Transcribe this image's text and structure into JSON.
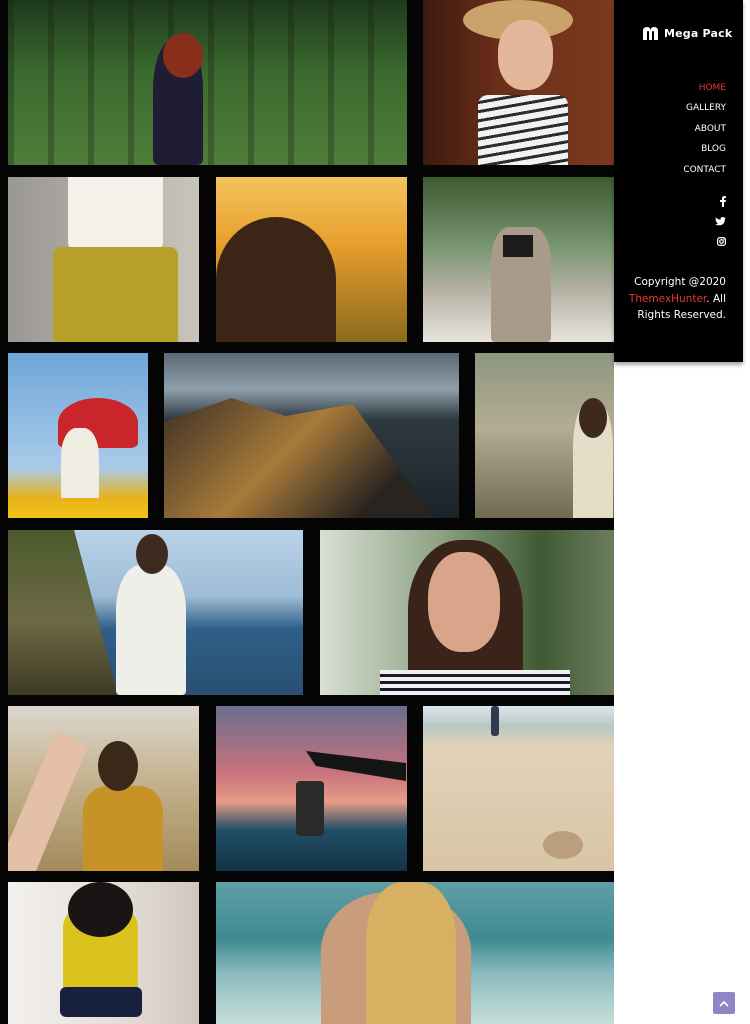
{
  "brand": {
    "name": "Mega Pack",
    "icon": "m-logo-icon"
  },
  "nav": {
    "items": [
      {
        "label": "HOME",
        "active": true
      },
      {
        "label": "GALLERY",
        "active": false
      },
      {
        "label": "ABOUT",
        "active": false
      },
      {
        "label": "BLOG",
        "active": false
      },
      {
        "label": "CONTACT",
        "active": false
      }
    ]
  },
  "social": {
    "icons": [
      "facebook-icon",
      "twitter-icon",
      "instagram-icon"
    ]
  },
  "footer": {
    "copyright_prefix": "Copyright @2020",
    "company": "ThemexHunter",
    "copyright_suffix": ". All Rights Reserved."
  },
  "colors": {
    "accent": "#e53935",
    "sidebar_bg": "#000000",
    "gallery_bg": "#050505",
    "scroll_top_bg": "#8f86c8"
  },
  "scroll_top": {
    "icon": "chevron-up-icon"
  },
  "gallery": {
    "photos": [
      "woman-in-forest",
      "woman-in-straw-hat",
      "woman-in-yellow-skirt",
      "woman-at-sunset-field",
      "woman-with-camera-on-beach",
      "woman-with-red-umbrella",
      "mountain-ridge-at-dusk",
      "woman-walking-on-shore",
      "couple-holding-hands-by-sea",
      "laughing-woman",
      "woman-taking-phone-photo",
      "hand-holding-lantern",
      "footprints-on-beach",
      "woman-in-yellow-top",
      "woman-in-sea"
    ]
  }
}
